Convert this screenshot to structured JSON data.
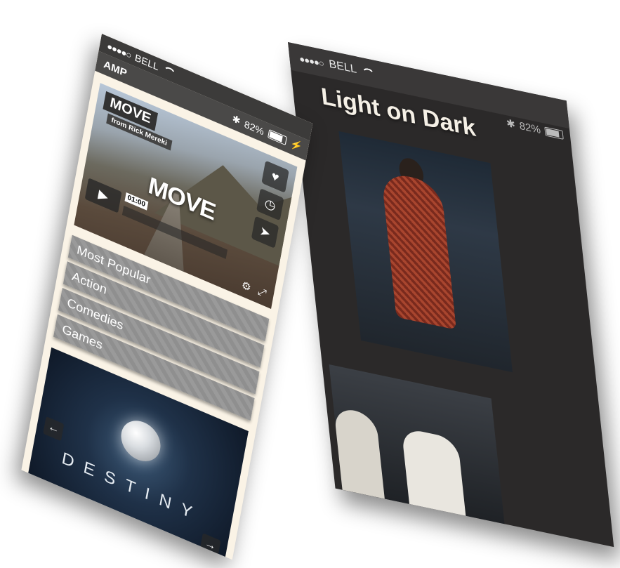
{
  "back_phone": {
    "status": {
      "dots": "●●●●○",
      "carrier": "BELL",
      "battery": "82%"
    },
    "title": "Light on Dark"
  },
  "front_phone": {
    "status": {
      "dots": "●●●●○",
      "carrier": "BELL",
      "battery": "82%"
    },
    "header": {
      "title": "AMP"
    },
    "video": {
      "title": "MOVE",
      "subtitle": "from Rick Mereki",
      "overlay_title": "MOVE",
      "time": "01:00",
      "play_glyph": "▶",
      "side_icons": [
        "heart-icon",
        "clock-icon",
        "send-icon"
      ],
      "side_glyphs": [
        "♥",
        "◷",
        "➤"
      ],
      "control_glyphs": [
        "⚙",
        "⤢"
      ]
    },
    "menu": [
      {
        "label": "Most Popular"
      },
      {
        "label": "Action"
      },
      {
        "label": "Comedies"
      },
      {
        "label": "Games"
      }
    ],
    "banner": {
      "title": "DESTINY",
      "prev_glyph": "←",
      "next_glyph": "→"
    }
  }
}
